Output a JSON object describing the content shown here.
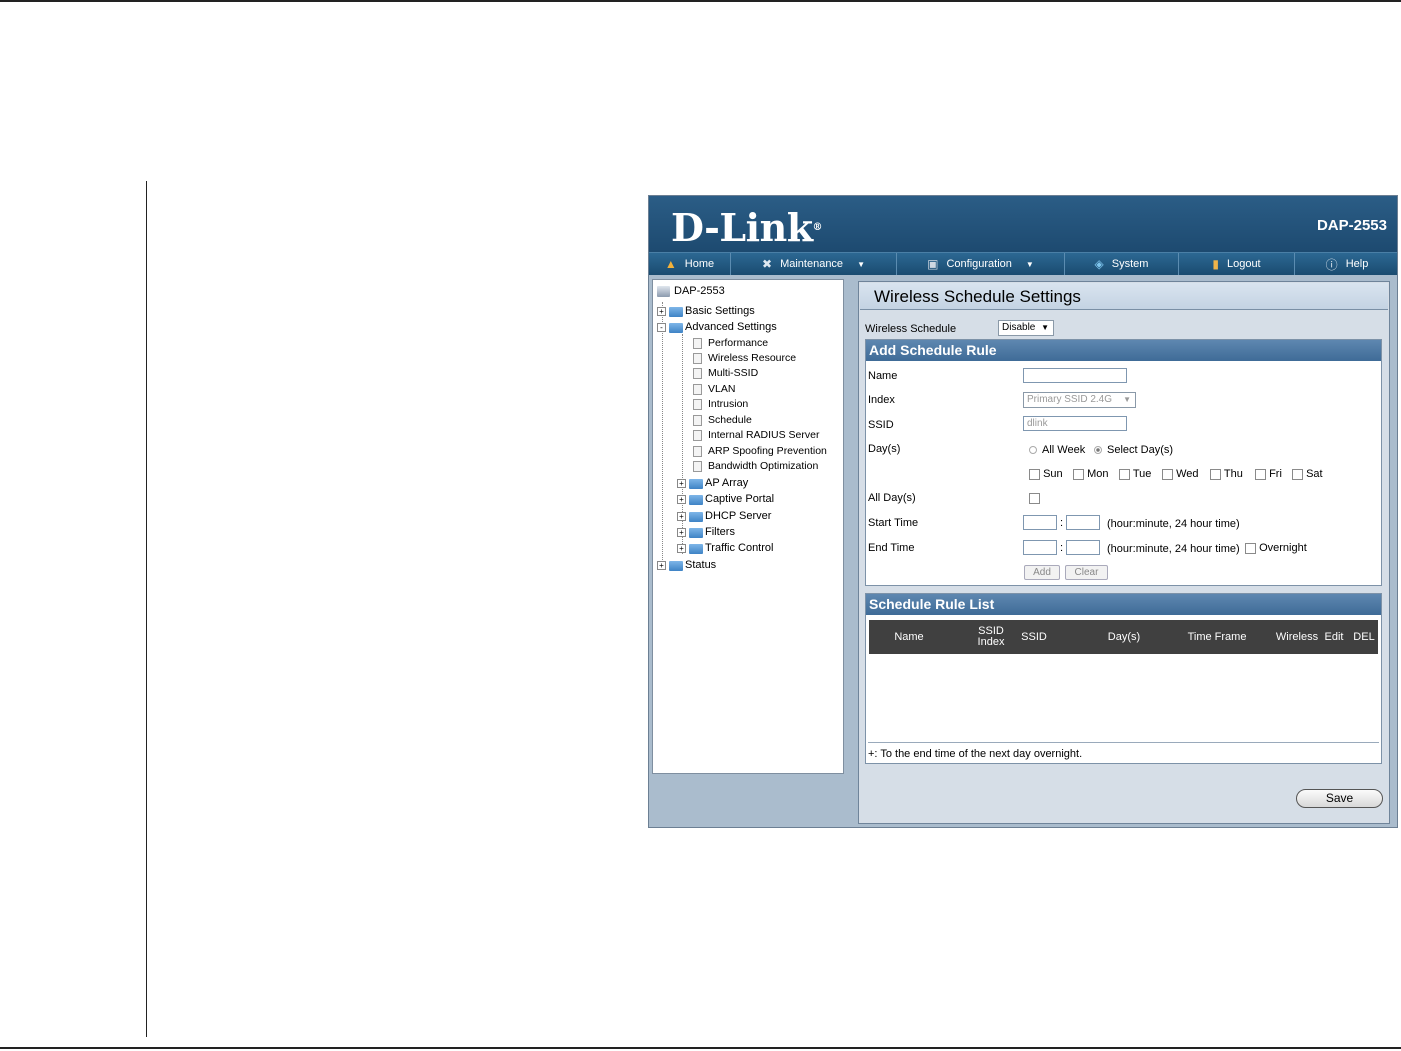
{
  "brand": {
    "logo": "D-Link",
    "logo_mark": "®",
    "model": "DAP-2553"
  },
  "menu": [
    {
      "label": "Home",
      "icon": "home-icon",
      "caret": false
    },
    {
      "label": "Maintenance",
      "icon": "tools-icon",
      "caret": true
    },
    {
      "label": "Configuration",
      "icon": "save-disk-icon",
      "caret": true
    },
    {
      "label": "System",
      "icon": "system-icon",
      "caret": false
    },
    {
      "label": "Logout",
      "icon": "logout-icon",
      "caret": false
    },
    {
      "label": "Help",
      "icon": "help-icon",
      "caret": false
    }
  ],
  "tree": {
    "root": "DAP-2553",
    "basic": "Basic Settings",
    "advanced": "Advanced Settings",
    "advanced_children": [
      "Performance",
      "Wireless Resource",
      "Multi-SSID",
      "VLAN",
      "Intrusion",
      "Schedule",
      "Internal RADIUS Server",
      "ARP Spoofing Prevention",
      "Bandwidth Optimization"
    ],
    "advanced_folders": [
      "AP Array",
      "Captive Portal",
      "DHCP Server",
      "Filters",
      "Traffic Control"
    ],
    "status": "Status"
  },
  "main": {
    "title": "Wireless Schedule Settings",
    "schedule_label": "Wireless Schedule",
    "schedule_value": "Disable"
  },
  "add_rule": {
    "heading": "Add Schedule Rule",
    "name_label": "Name",
    "index_label": "Index",
    "index_value": "Primary SSID 2.4G",
    "ssid_label": "SSID",
    "ssid_value": "dlink",
    "days_label": "Day(s)",
    "all_week": "All Week",
    "select_days": "Select Day(s)",
    "days": [
      "Sun",
      "Mon",
      "Tue",
      "Wed",
      "Thu",
      "Fri",
      "Sat"
    ],
    "all_day_label": "All Day(s)",
    "start_label": "Start Time",
    "end_label": "End Time",
    "time_sep": ":",
    "time_hint": "(hour:minute, 24 hour time)",
    "overnight": "Overnight",
    "add_btn": "Add",
    "clear_btn": "Clear"
  },
  "rule_list": {
    "heading": "Schedule Rule List",
    "columns": [
      "Name",
      "SSID Index",
      "SSID",
      "Day(s)",
      "Time Frame",
      "Wireless",
      "Edit",
      "DEL"
    ],
    "footnote": "+: To the end time of the next day overnight."
  },
  "save_btn": "Save"
}
